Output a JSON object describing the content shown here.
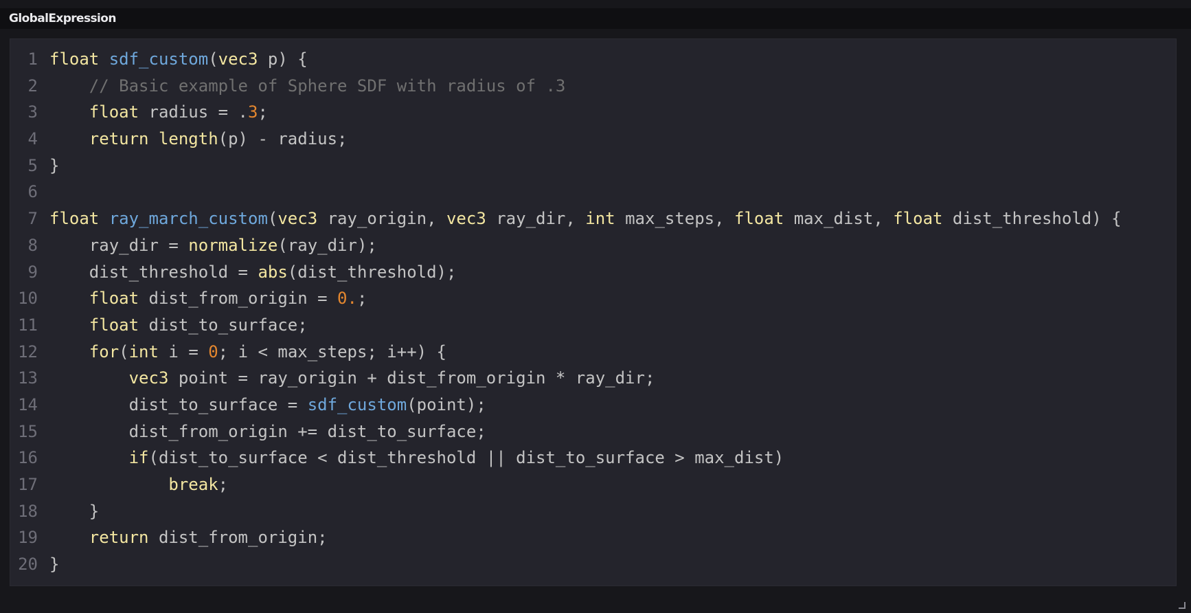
{
  "node": {
    "title": "GlobalExpression"
  },
  "editor": {
    "lines": [
      {
        "number": "1",
        "tokens": [
          {
            "t": "kw",
            "v": "float"
          },
          {
            "t": "pl",
            "v": " "
          },
          {
            "t": "fn",
            "v": "sdf_custom"
          },
          {
            "t": "pl",
            "v": "("
          },
          {
            "t": "kw",
            "v": "vec3"
          },
          {
            "t": "pl",
            "v": " p) {"
          }
        ]
      },
      {
        "number": "2",
        "tokens": [
          {
            "t": "pl",
            "v": "    "
          },
          {
            "t": "cm",
            "v": "// Basic example of Sphere SDF with radius of .3"
          }
        ]
      },
      {
        "number": "3",
        "tokens": [
          {
            "t": "pl",
            "v": "    "
          },
          {
            "t": "kw",
            "v": "float"
          },
          {
            "t": "pl",
            "v": " radius = ."
          },
          {
            "t": "nm",
            "v": "3"
          },
          {
            "t": "pl",
            "v": ";"
          }
        ]
      },
      {
        "number": "4",
        "tokens": [
          {
            "t": "pl",
            "v": "    "
          },
          {
            "t": "kw",
            "v": "return"
          },
          {
            "t": "pl",
            "v": " "
          },
          {
            "t": "bf",
            "v": "length"
          },
          {
            "t": "pl",
            "v": "(p) - radius;"
          }
        ]
      },
      {
        "number": "5",
        "tokens": [
          {
            "t": "pl",
            "v": "}"
          }
        ]
      },
      {
        "number": "6",
        "tokens": []
      },
      {
        "number": "7",
        "tokens": [
          {
            "t": "kw",
            "v": "float"
          },
          {
            "t": "pl",
            "v": " "
          },
          {
            "t": "fn",
            "v": "ray_march_custom"
          },
          {
            "t": "pl",
            "v": "("
          },
          {
            "t": "kw",
            "v": "vec3"
          },
          {
            "t": "pl",
            "v": " ray_origin, "
          },
          {
            "t": "kw",
            "v": "vec3"
          },
          {
            "t": "pl",
            "v": " ray_dir, "
          },
          {
            "t": "kw",
            "v": "int"
          },
          {
            "t": "pl",
            "v": " max_steps, "
          },
          {
            "t": "kw",
            "v": "float"
          },
          {
            "t": "pl",
            "v": " max_dist, "
          },
          {
            "t": "kw",
            "v": "float"
          },
          {
            "t": "pl",
            "v": " dist_threshold) {"
          }
        ]
      },
      {
        "number": "8",
        "tokens": [
          {
            "t": "pl",
            "v": "    ray_dir = "
          },
          {
            "t": "bf",
            "v": "normalize"
          },
          {
            "t": "pl",
            "v": "(ray_dir);"
          }
        ]
      },
      {
        "number": "9",
        "tokens": [
          {
            "t": "pl",
            "v": "    dist_threshold = "
          },
          {
            "t": "bf",
            "v": "abs"
          },
          {
            "t": "pl",
            "v": "(dist_threshold);"
          }
        ]
      },
      {
        "number": "10",
        "tokens": [
          {
            "t": "pl",
            "v": "    "
          },
          {
            "t": "kw",
            "v": "float"
          },
          {
            "t": "pl",
            "v": " dist_from_origin = "
          },
          {
            "t": "nm",
            "v": "0."
          },
          {
            "t": "pl",
            "v": ";"
          }
        ]
      },
      {
        "number": "11",
        "tokens": [
          {
            "t": "pl",
            "v": "    "
          },
          {
            "t": "kw",
            "v": "float"
          },
          {
            "t": "pl",
            "v": " dist_to_surface;"
          }
        ]
      },
      {
        "number": "12",
        "tokens": [
          {
            "t": "pl",
            "v": "    "
          },
          {
            "t": "kw",
            "v": "for"
          },
          {
            "t": "pl",
            "v": "("
          },
          {
            "t": "kw",
            "v": "int"
          },
          {
            "t": "pl",
            "v": " i = "
          },
          {
            "t": "nm",
            "v": "0"
          },
          {
            "t": "pl",
            "v": "; i < max_steps; i++) {"
          }
        ]
      },
      {
        "number": "13",
        "tokens": [
          {
            "t": "pl",
            "v": "        "
          },
          {
            "t": "kw",
            "v": "vec3"
          },
          {
            "t": "pl",
            "v": " point = ray_origin + dist_from_origin * ray_dir;"
          }
        ]
      },
      {
        "number": "14",
        "tokens": [
          {
            "t": "pl",
            "v": "        dist_to_surface = "
          },
          {
            "t": "fn",
            "v": "sdf_custom"
          },
          {
            "t": "pl",
            "v": "(point);"
          }
        ]
      },
      {
        "number": "15",
        "tokens": [
          {
            "t": "pl",
            "v": "        dist_from_origin += dist_to_surface;"
          }
        ]
      },
      {
        "number": "16",
        "tokens": [
          {
            "t": "pl",
            "v": "        "
          },
          {
            "t": "kw",
            "v": "if"
          },
          {
            "t": "pl",
            "v": "(dist_to_surface < dist_threshold || dist_to_surface > max_dist)"
          }
        ]
      },
      {
        "number": "17",
        "tokens": [
          {
            "t": "pl",
            "v": "            "
          },
          {
            "t": "kw",
            "v": "break"
          },
          {
            "t": "pl",
            "v": ";"
          }
        ]
      },
      {
        "number": "18",
        "tokens": [
          {
            "t": "pl",
            "v": "    }"
          }
        ]
      },
      {
        "number": "19",
        "tokens": [
          {
            "t": "pl",
            "v": "    "
          },
          {
            "t": "kw",
            "v": "return"
          },
          {
            "t": "pl",
            "v": " dist_from_origin;"
          }
        ]
      },
      {
        "number": "20",
        "tokens": [
          {
            "t": "pl",
            "v": "}"
          }
        ]
      }
    ]
  },
  "colors": {
    "background": "#17171b",
    "editor_background": "#24242c",
    "keyword": "#f3e6a1",
    "function": "#6fa8dc",
    "comment": "#707070",
    "number": "#e4872f",
    "plain": "#c4c4c4",
    "line_number": "#6e6e78"
  }
}
